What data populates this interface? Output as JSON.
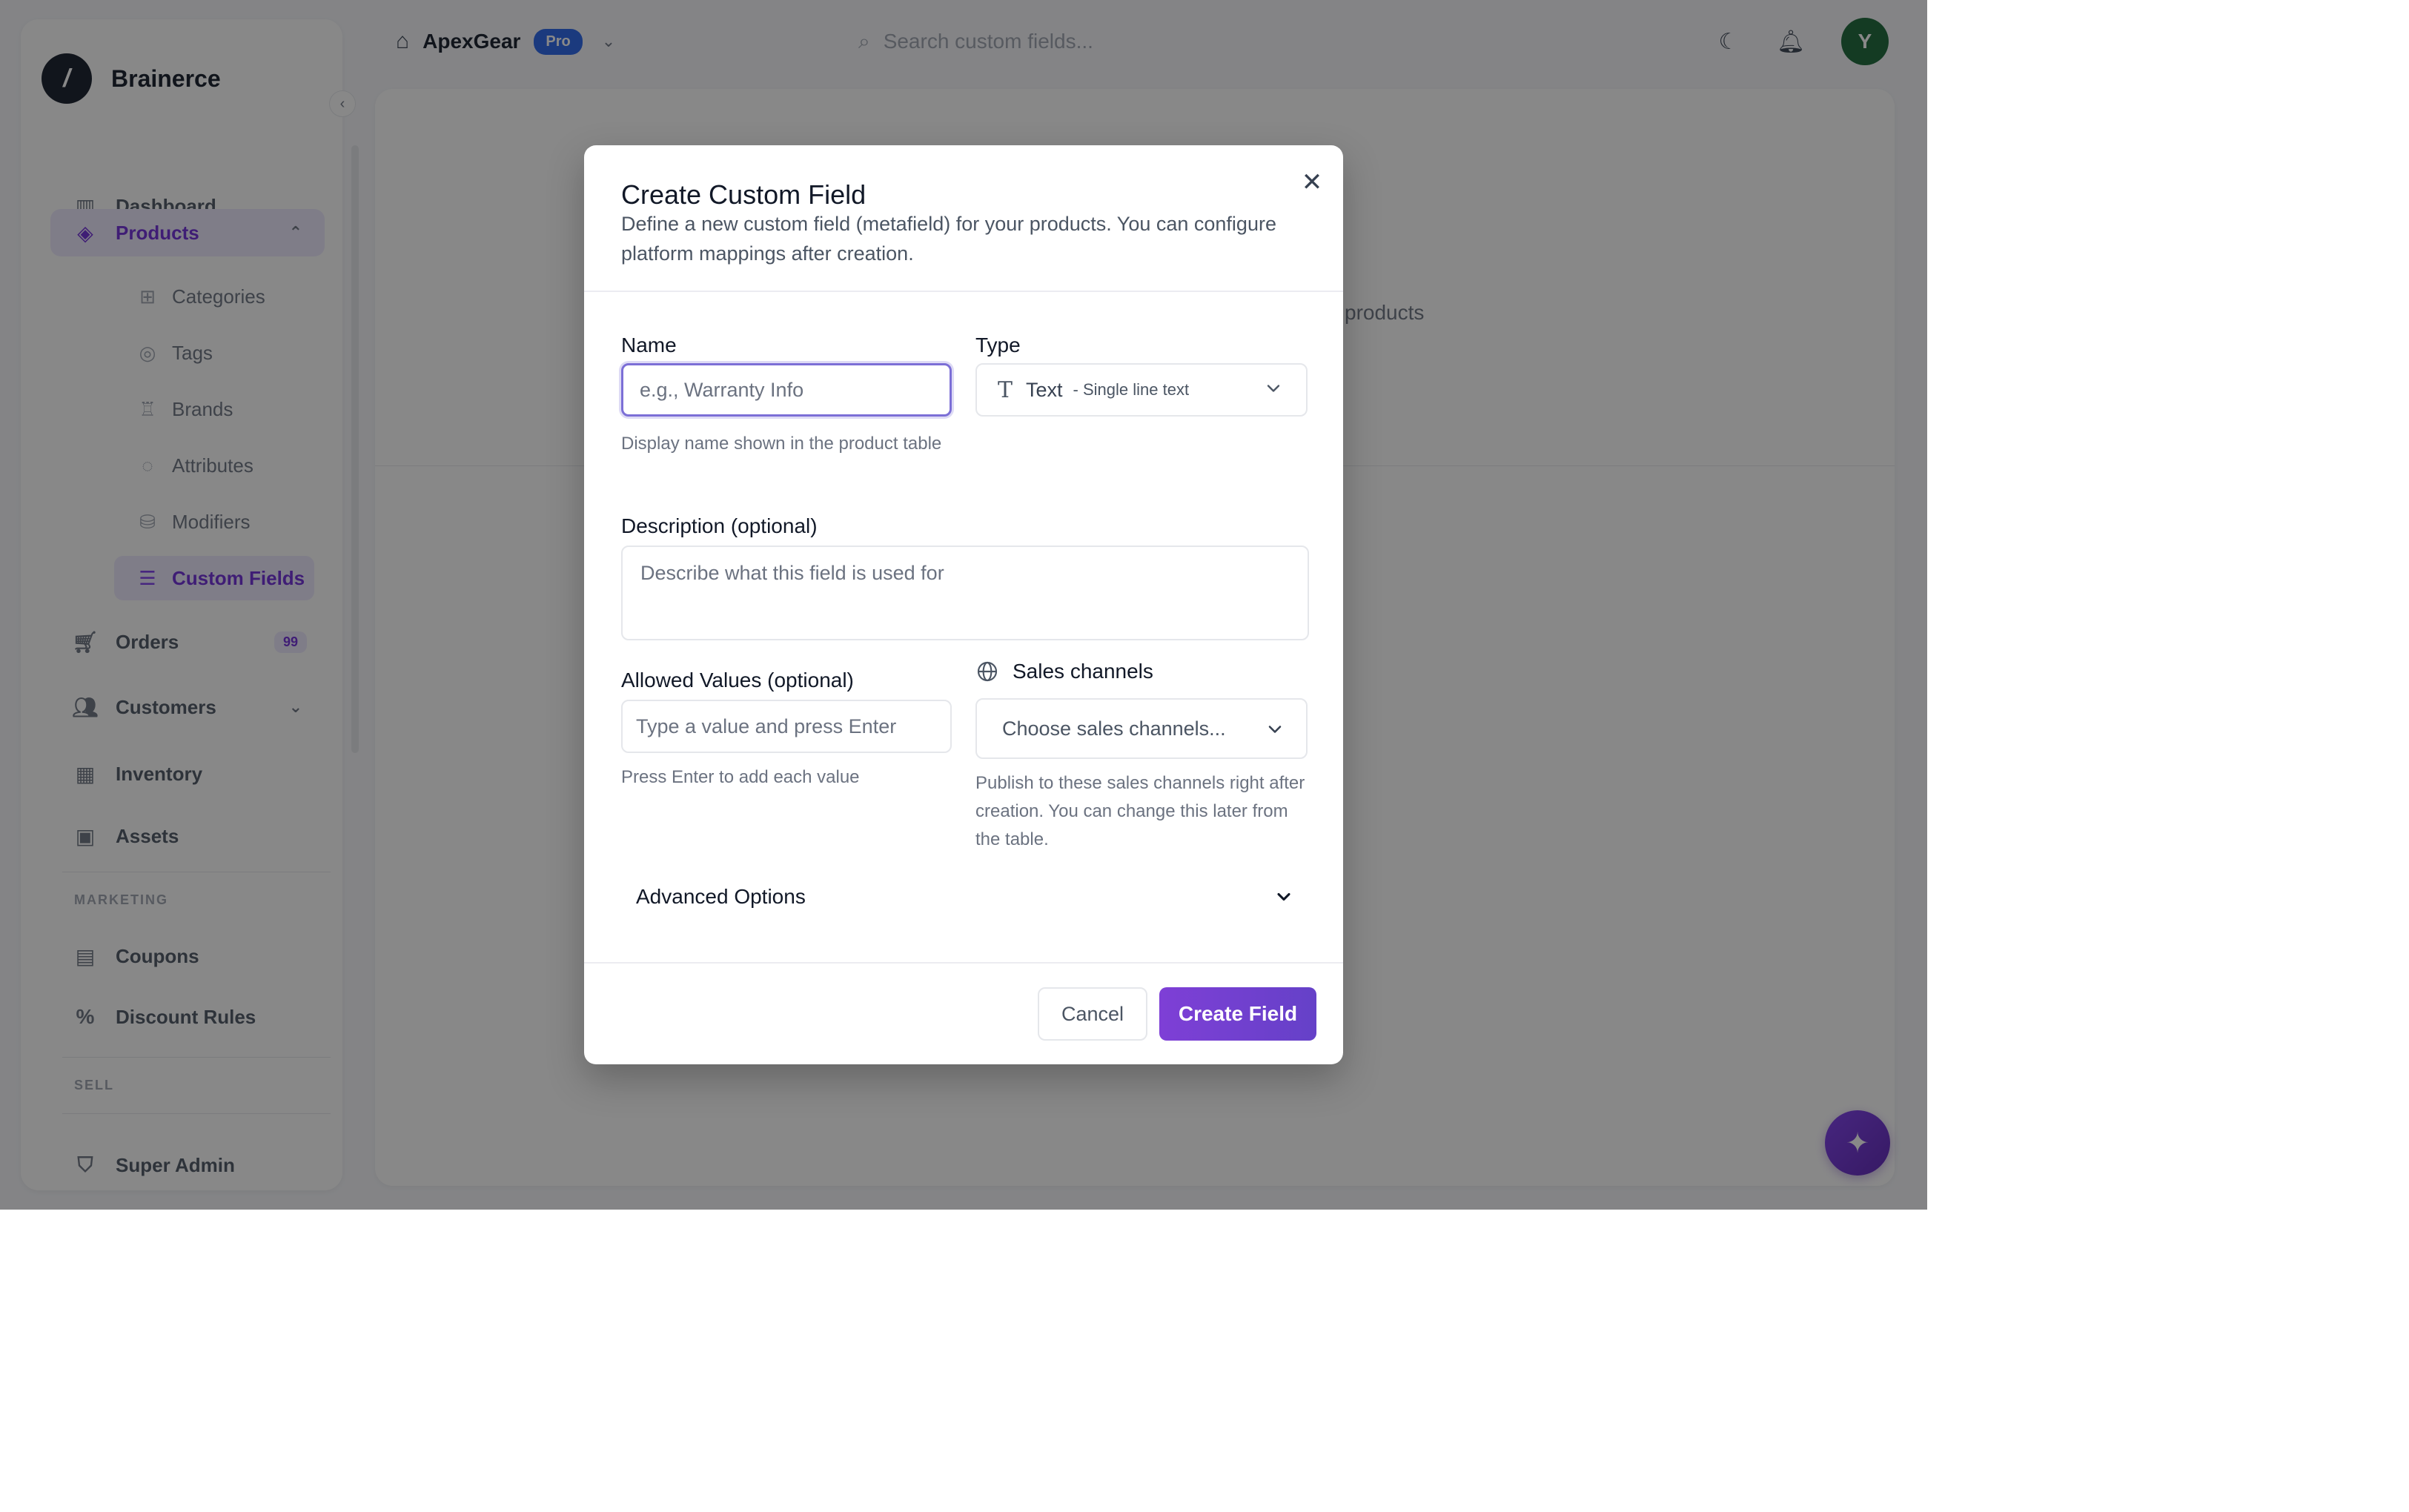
{
  "app": {
    "brand": "Brainerce",
    "store": {
      "name": "ApexGear",
      "plan_badge": "Pro"
    },
    "search": {
      "placeholder": "Search custom fields..."
    },
    "avatar_initial": "Y"
  },
  "sidebar": {
    "items": [
      {
        "label": "Dashboard",
        "icon": "dashboard-icon"
      },
      {
        "label": "Products",
        "icon": "products-icon"
      },
      {
        "label": "Orders",
        "icon": "cart-icon",
        "badge": "99"
      },
      {
        "label": "Customers",
        "icon": "users-icon"
      },
      {
        "label": "Inventory",
        "icon": "inventory-icon"
      },
      {
        "label": "Assets",
        "icon": "image-icon"
      },
      {
        "label": "Coupons",
        "icon": "ticket-icon"
      },
      {
        "label": "Discount Rules",
        "icon": "percent-icon"
      },
      {
        "label": "Super Admin",
        "icon": "shield-icon"
      }
    ],
    "sub_items": [
      {
        "label": "Categories"
      },
      {
        "label": "Tags"
      },
      {
        "label": "Brands"
      },
      {
        "label": "Attributes"
      },
      {
        "label": "Modifiers"
      },
      {
        "label": "Custom Fields"
      }
    ],
    "sections": {
      "marketing": "MARKETING",
      "sell": "SELL"
    }
  },
  "background": {
    "products_text": "products"
  },
  "modal": {
    "title": "Create Custom Field",
    "description": "Define a new custom field (metafield) for your products. You can configure platform mappings after creation.",
    "name": {
      "label": "Name",
      "placeholder": "e.g., Warranty Info",
      "value": "",
      "help": "Display name shown in the product table"
    },
    "type": {
      "label": "Type",
      "selected": "Text",
      "selected_sub": "- Single line text"
    },
    "description_field": {
      "label": "Description (optional)",
      "placeholder": "Describe what this field is used for",
      "value": ""
    },
    "allowed_values": {
      "label": "Allowed Values (optional)",
      "placeholder": "Type a value and press Enter",
      "help": "Press Enter to add each value"
    },
    "sales_channels": {
      "label": "Sales channels",
      "placeholder": "Choose sales channels...",
      "help": "Publish to these sales channels right after creation. You can change this later from the table."
    },
    "advanced": {
      "label": "Advanced Options"
    },
    "buttons": {
      "cancel": "Cancel",
      "create": "Create Field"
    }
  },
  "colors": {
    "accent": "#7c3aed",
    "primary_button": "#7047cf",
    "pro_badge": "#2563eb",
    "avatar": "#166534",
    "overlay": "rgba(18,18,18,0.5)"
  }
}
